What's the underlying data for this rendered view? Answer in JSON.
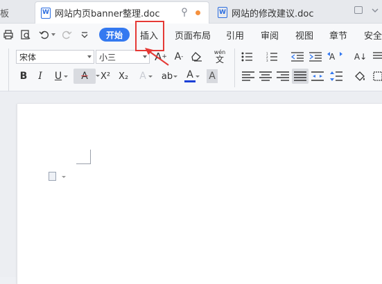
{
  "tabs": {
    "partial_label": "板",
    "active_title": "网站内页banner整理.doc",
    "second_title": "网站的修改建议.doc",
    "doc_icon_letter": "W"
  },
  "menu": {
    "start": "开始",
    "insert": "插入",
    "page_layout": "页面布局",
    "references": "引用",
    "review": "审阅",
    "view": "视图",
    "sections": "章节",
    "security": "安全"
  },
  "ribbon": {
    "font_name": "宋体",
    "font_size": "小三",
    "bold": "B",
    "italic": "I",
    "underline": "U",
    "strike_a": "A",
    "superscript": "X²",
    "subscript": "X₂",
    "font_color_a": "A",
    "shade_a": "A",
    "grow_a": "A",
    "shrink_a": "A",
    "effect_a": "A",
    "pinyin": "wén",
    "sort": "A↓"
  },
  "colors": {
    "accent": "#3479f0",
    "highlight": "#e53935",
    "font_color_bar": "#1a3fd6",
    "unsaved_dot": "#f5913e"
  }
}
